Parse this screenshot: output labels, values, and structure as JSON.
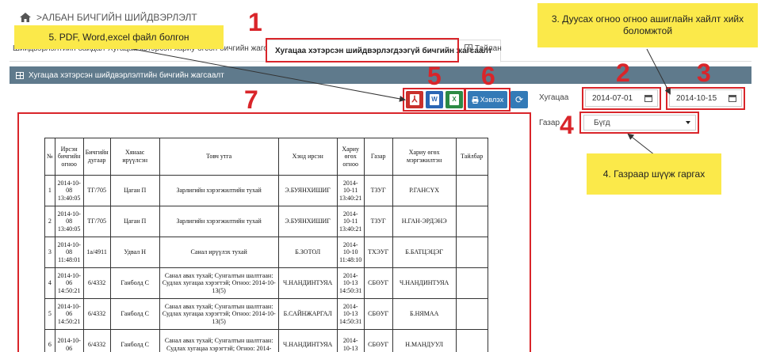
{
  "breadcrumb": {
    "title": ">АЛБАН БИЧГИЙН ШИЙДВЭРЛЭЛТ"
  },
  "tabs": [
    {
      "label": "Шийдвэрлэлтийн байдал"
    },
    {
      "label": "Хугацаа хэтэрсэн хариу өгсөн бичгийн жагсаалт"
    },
    {
      "label": "Хугацаа хэтэрсэн шийдвэрлэгдээгүй бичгийн жагсаалт"
    },
    {
      "label": "Тайлан"
    }
  ],
  "panel": {
    "title": "Хугацаа хэтэрсэн шийдвэрлэлтийн бичгийн жагсаалт"
  },
  "toolbar": {
    "pdf_icon": "pdf-icon",
    "word_icon": "word-icon",
    "excel_icon": "excel-icon",
    "print_label": "Хэвлэх",
    "refresh_icon": "refresh-icon"
  },
  "filters": {
    "period_label": "Хугацаа",
    "date_from": "2014-07-01",
    "date_to": "2014-10-15",
    "place_label": "Газар",
    "place_value": "Бүгд"
  },
  "callouts": {
    "c5": "5. PDF, Word,excel файл болгон",
    "c3": "3. Дуусах огноо огноо ашиглайн хайлт хийх боломжтой",
    "c4": "4. Газраар шүүж гаргах"
  },
  "markers": {
    "m1": "1",
    "m2": "2",
    "m3": "3",
    "m4": "4",
    "m5": "5",
    "m6": "6",
    "m7": "7"
  },
  "table": {
    "headers": [
      "№",
      "Ирсэн бичгийн огноо",
      "Бичгийн дугаар",
      "Хянаас ирүүлсэн",
      "Товч утга",
      "Хэнд ирсэн",
      "Хариу өгөх огноо",
      "Газар",
      "Хариу өгөх мэргэжилтэн",
      "Тайлбар"
    ],
    "rows": [
      [
        "1",
        "2014-10-08 13:40:05",
        "ТГ/705",
        "Цаган П",
        "Зарлигийн хэрэгжилтийн тухай",
        "Э.БУЯНХИШИГ",
        "2014-10-11 13:40:21",
        "ТЗУГ",
        "Р.ГАНСҮХ",
        ""
      ],
      [
        "2",
        "2014-10-08 13:40:05",
        "ТГ/705",
        "Цаган П",
        "Зарлигийн хэрэгжилтийн тухай",
        "Э.БУЯНХИШИГ",
        "2014-10-11 13:40:21",
        "ТЗУГ",
        "Н.ГАН-ЭРДЭНЭ",
        ""
      ],
      [
        "3",
        "2014-10-08 11:48:01",
        "1а/4911",
        "Удвал Н",
        "Санал ирүүлэх тухай",
        "Б.ЗОТОЛ",
        "2014-10-10 11:48:10",
        "ТХЭУГ",
        "Б.БАТЦЭЦЭГ",
        ""
      ],
      [
        "4",
        "2014-10-06 14:50:21",
        "6/4332",
        "Ганболд С",
        "Санал авах тухай; Сунгалтын шалтгаан: Судлах хугацаа хэрэгтэй; Огноо: 2014-10-13(5)",
        "Ч.НАНДИНТУЯА",
        "2014-10-13 14:50:31",
        "СБӨУГ",
        "Ч.НАНДИНТУЯА",
        ""
      ],
      [
        "5",
        "2014-10-06 14:50:21",
        "6/4332",
        "Ганболд С",
        "Санал авах тухай; Сунгалтын шалтгаан: Судлах хугацаа хэрэгтэй; Огноо: 2014-10-13(5)",
        "Б.САЙНЖАРГАЛ",
        "2014-10-13 14:50:31",
        "СБӨУГ",
        "Б.НЯМАА",
        ""
      ],
      [
        "6",
        "2014-10-06",
        "6/4332",
        "Ганболд С",
        "Санал авах тухай; Сунгалтын шалтгаан: Судлах хугацаа хэрэгтэй; Огноо: 2014-",
        "Ч.НАНДИНТУЯА",
        "2014-10-13",
        "СБӨУГ",
        "Н.МАНДУУЛ",
        ""
      ]
    ]
  }
}
